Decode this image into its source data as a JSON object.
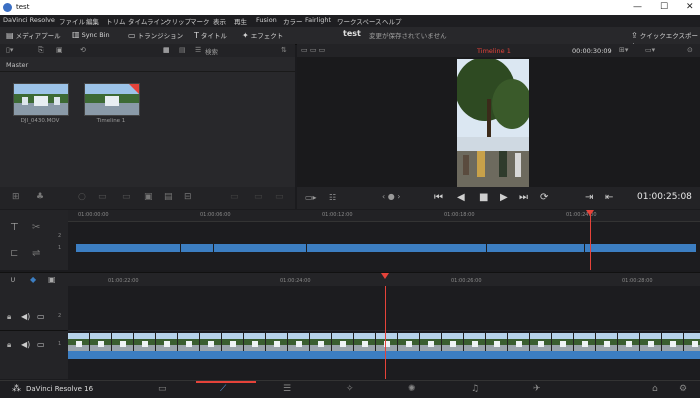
{
  "window": {
    "title": "test",
    "minimize": "—",
    "maximize": "☐",
    "close": "✕"
  },
  "menu": [
    "DaVinci Resolve",
    "ファイル",
    "編集",
    "トリム",
    "タイムライン",
    "クリップ",
    "マーク",
    "表示",
    "再生",
    "Fusion",
    "カラー",
    "Fairlight",
    "ワークスペース",
    "ヘルプ"
  ],
  "toolbar": {
    "media_pool": "メディアプール",
    "sync_bin": "Sync Bin",
    "transitions": "トランジション",
    "titles": "タイトル",
    "effects": "エフェクト",
    "project_name": "test",
    "save_status": "変更が保存されていません",
    "quick_export": "クイックエクスポート"
  },
  "pool": {
    "search_label": "検索",
    "bin": "Master",
    "clips": [
      {
        "name": "DJI_0430.MOV"
      },
      {
        "name": "Timeline 1"
      }
    ]
  },
  "viewer": {
    "timeline_name": "Timeline 1",
    "duration": "00:00:30:09",
    "timecode": "01:00:25:08"
  },
  "upper_timeline": {
    "ruler": [
      "01:00:00:00",
      "01:00:06:00",
      "01:00:12:00",
      "01:00:18:00",
      "01:00:24:00"
    ],
    "tracks": [
      "2",
      "1"
    ]
  },
  "lower_timeline": {
    "ruler": [
      "01:00:22:00",
      "01:00:24:00",
      "01:00:26:00",
      "01:00:28:00"
    ],
    "tracks": [
      "2",
      "1"
    ]
  },
  "bottom": {
    "app_label": "DaVinci Resolve 16"
  },
  "colors": {
    "accent_red": "#e5433a",
    "clip_blue": "#3c7ec2",
    "bg": "#1b1b1e"
  }
}
